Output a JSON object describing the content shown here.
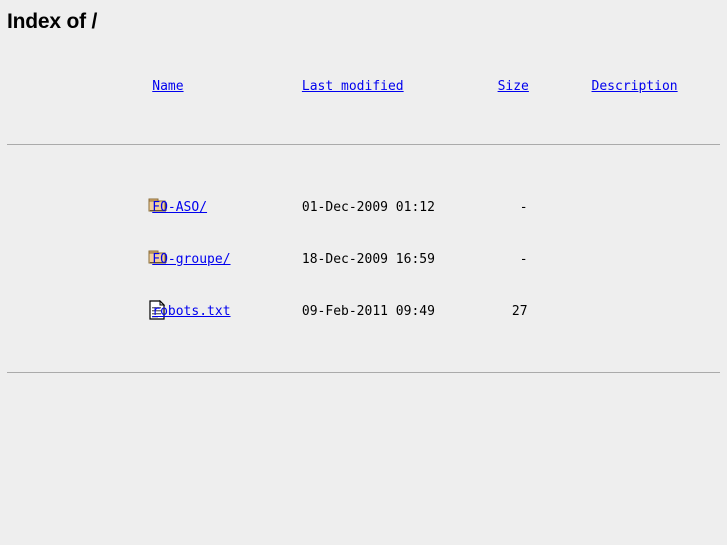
{
  "page": {
    "title": "Index of /",
    "directory": "/",
    "background_color": "#eeeeee",
    "link_color": "#0000ee",
    "rule_color": "#aaaaaa"
  },
  "table": {
    "headers": {
      "icon": "",
      "name": "Name",
      "last_modified": "Last modified",
      "size": "Size",
      "description": "Description"
    },
    "entries": [
      {
        "icon": "folder-icon",
        "name": "FO-ASO/",
        "last_modified": "01-Dec-2009 01:12",
        "size": "-",
        "description": ""
      },
      {
        "icon": "folder-icon",
        "name": "FO-groupe/",
        "last_modified": "18-Dec-2009 16:59",
        "size": "-",
        "description": ""
      },
      {
        "icon": "text-file-icon",
        "name": "robots.txt",
        "last_modified": "09-Feb-2011 09:49",
        "size": "27",
        "description": ""
      }
    ]
  }
}
